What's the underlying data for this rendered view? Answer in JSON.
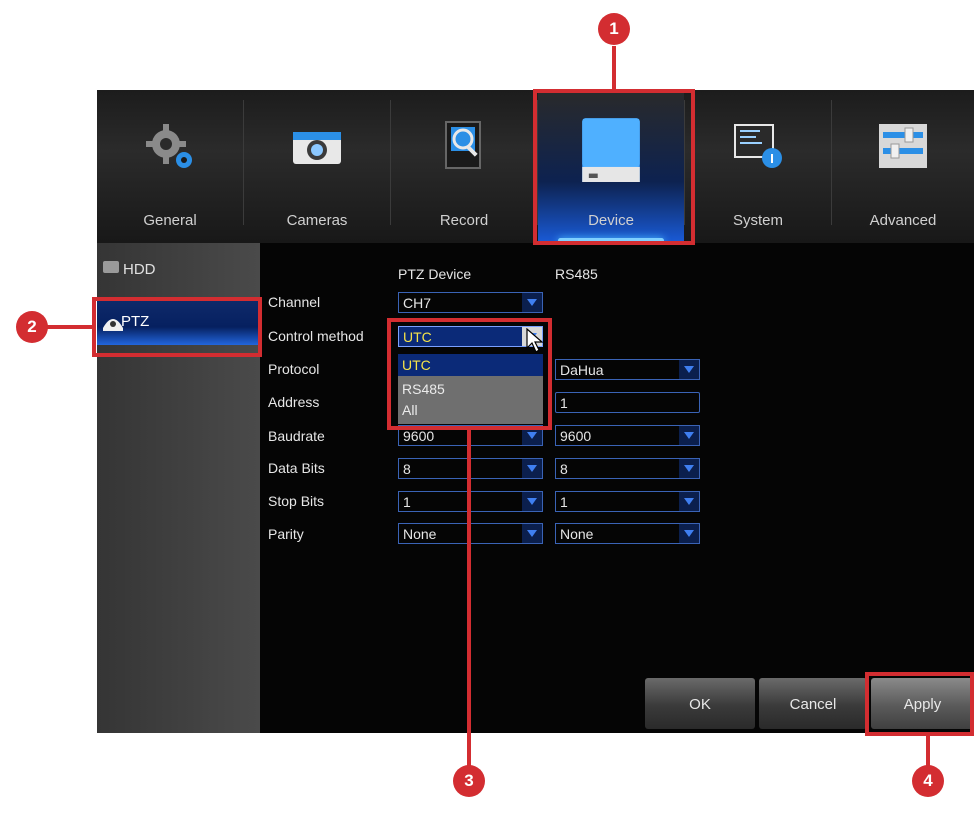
{
  "nav": {
    "tabs": [
      {
        "label": "General",
        "icon": "gears-icon"
      },
      {
        "label": "Cameras",
        "icon": "camera-icon"
      },
      {
        "label": "Record",
        "icon": "record-search-icon"
      },
      {
        "label": "Device",
        "icon": "hard-drive-icon",
        "active": true
      },
      {
        "label": "System",
        "icon": "system-info-icon"
      },
      {
        "label": "Advanced",
        "icon": "sliders-icon"
      }
    ]
  },
  "sidebar": {
    "items": [
      {
        "label": "HDD",
        "icon": "hdd-icon"
      },
      {
        "label": "PTZ",
        "icon": "ptz-camera-icon",
        "selected": true
      }
    ]
  },
  "form": {
    "headers": {
      "col1": "PTZ Device",
      "col2": "RS485"
    },
    "labels": {
      "channel": "Channel",
      "control_method": "Control method",
      "protocol": "Protocol",
      "address": "Address",
      "baudrate": "Baudrate",
      "data_bits": "Data Bits",
      "stop_bits": "Stop Bits",
      "parity": "Parity"
    },
    "channel": "CH7",
    "control_method": "UTC",
    "rs485": {
      "protocol": "DaHua",
      "address": "1",
      "baudrate": "9600",
      "data_bits": "8",
      "stop_bits": "1",
      "parity": "None"
    },
    "ptz": {
      "baudrate": "9600",
      "data_bits": "8",
      "stop_bits": "1",
      "parity": "None"
    }
  },
  "dropdown": {
    "options": [
      "UTC",
      "RS485",
      "All"
    ],
    "highlighted": "UTC"
  },
  "buttons": {
    "ok": "OK",
    "cancel": "Cancel",
    "apply": "Apply"
  },
  "callouts": [
    "1",
    "2",
    "3",
    "4"
  ],
  "colors": {
    "callout": "#d32d31",
    "accent": "#1a5bd8",
    "highlight": "#0b2a78",
    "value_yellow": "#f5e34a"
  }
}
